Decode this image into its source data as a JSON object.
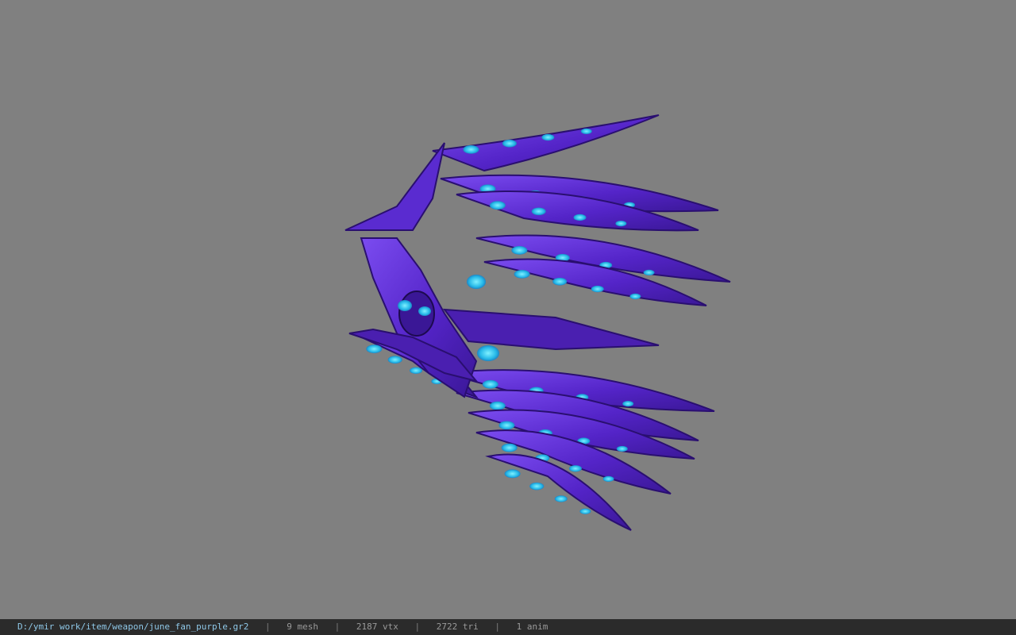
{
  "viewer": {
    "background_color": "#808080",
    "model_primary_color": "#5a2bd0",
    "model_glow_color": "#2fd0f0",
    "model_icon": "purple-fan-weapon-model"
  },
  "status": {
    "path": "D:/ymir work/item/weapon/june_fan_purple.gr2",
    "sep": "|",
    "mesh": "9 mesh",
    "vtx": "2187 vtx",
    "tri": "2722 tri",
    "anim": "1 anim"
  }
}
